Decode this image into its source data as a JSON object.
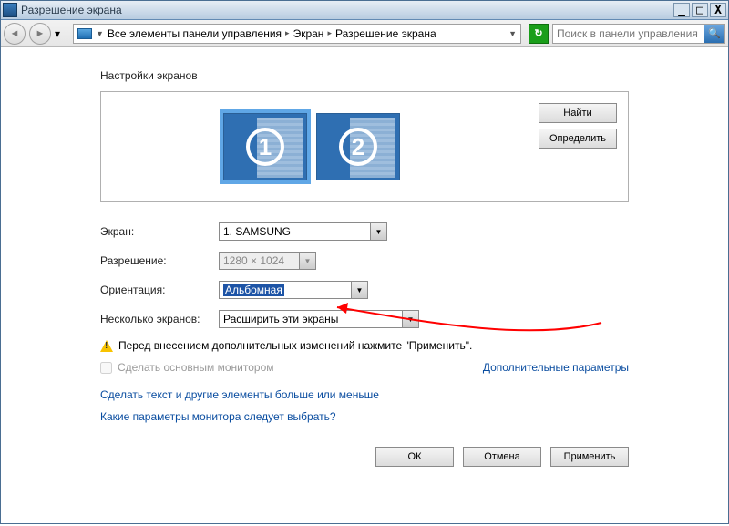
{
  "window": {
    "title": "Разрешение экрана"
  },
  "toolbar": {
    "breadcrumb": [
      "Все элементы панели управления",
      "Экран",
      "Разрешение экрана"
    ],
    "search_placeholder": "Поиск в панели управления"
  },
  "heading": "Настройки экранов",
  "panel": {
    "find_label": "Найти",
    "identify_label": "Определить",
    "monitors": [
      {
        "num": "1",
        "selected": true
      },
      {
        "num": "2",
        "selected": false
      }
    ]
  },
  "form": {
    "screen_label": "Экран:",
    "screen_value": "1. SAMSUNG",
    "resolution_label": "Разрешение:",
    "resolution_value": "1280 × 1024",
    "orientation_label": "Ориентация:",
    "orientation_value": "Альбомная",
    "multi_label": "Несколько экранов:",
    "multi_value": "Расширить эти экраны"
  },
  "alert_text": "Перед внесением дополнительных изменений нажмите \"Применить\".",
  "checkbox_label": "Сделать основным монитором",
  "advanced_link": "Дополнительные параметры",
  "links": {
    "text_size": "Сделать текст и другие элементы больше или меньше",
    "which_monitor": "Какие параметры монитора следует выбрать?"
  },
  "buttons": {
    "ok": "ОК",
    "cancel": "Отмена",
    "apply": "Применить"
  }
}
